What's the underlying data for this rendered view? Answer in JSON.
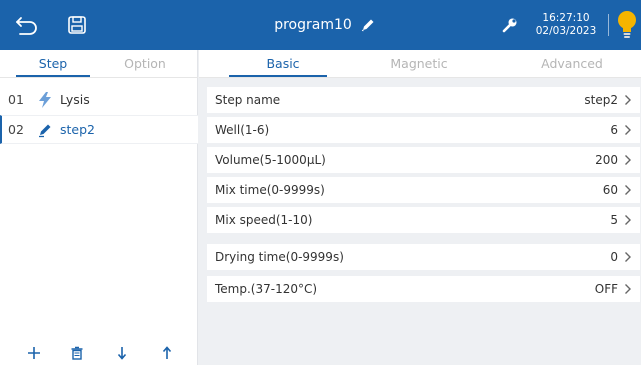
{
  "header": {
    "title": "program10",
    "time": "16:27:10",
    "date": "02/03/2023",
    "icons": [
      "back-icon",
      "save-icon",
      "edit-icon",
      "wrench-icon",
      "lightbulb-icon"
    ],
    "colors": {
      "bar": "#1b63ab",
      "bulb": "#f5b400"
    }
  },
  "left_tabs": [
    "Step",
    "Option"
  ],
  "steps": [
    {
      "num": "01",
      "label": "Lysis",
      "icon": "lightning-icon"
    },
    {
      "num": "02",
      "label": "step2",
      "icon": "pencil-icon"
    }
  ],
  "step_actions": [
    "add-icon",
    "delete-icon",
    "arrow-down-icon",
    "arrow-up-icon"
  ],
  "right_tabs": [
    "Basic",
    "Magnetic",
    "Advanced"
  ],
  "params": [
    {
      "label": "Step name",
      "value": "step2"
    },
    {
      "label": "Well(1-6)",
      "value": "6"
    },
    {
      "label": "Volume(5-1000µL)",
      "value": "200"
    },
    {
      "label": "Mix time(0-9999s)",
      "value": "60"
    },
    {
      "label": "Mix speed(1-10)",
      "value": "5"
    },
    {
      "label": "Drying time(0-9999s)",
      "value": "0"
    },
    {
      "label": "Temp.(37-120°C)",
      "value": "OFF"
    }
  ]
}
